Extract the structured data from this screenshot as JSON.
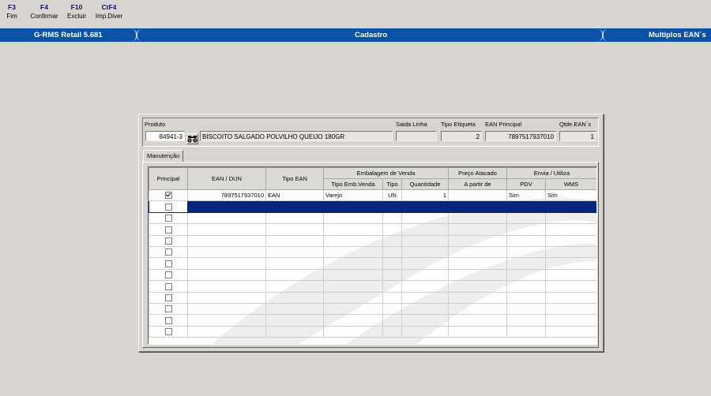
{
  "fkeys": [
    {
      "key": "F3",
      "label": "Fim"
    },
    {
      "key": "F4",
      "label": "Confirmar"
    },
    {
      "key": "F10",
      "label": "Excluir"
    },
    {
      "key": "CtF4",
      "label": "Imp.Diver"
    }
  ],
  "titlebar": {
    "app": "G-RMS Retail 5.681",
    "screen": "Cadastro",
    "context": "Multiplos EAN´s"
  },
  "header": {
    "produto_label": "Produto",
    "produto_code": "84941-3",
    "produto_desc": "BISCOITO SALGADO POLVILHO QUEIJO 180GR",
    "saida_linha_label": "Saida Linha",
    "saida_linha": "",
    "tipo_etiqueta_label": "Tipo Etiqueta",
    "tipo_etiqueta": "2",
    "ean_principal_label": "EAN Principal",
    "ean_principal": "7897517937010",
    "qtde_ean_label": "Qtde.EAN´s",
    "qtde_ean": "1"
  },
  "tab": "Manutenção",
  "columns": {
    "principal": "Principal",
    "ean_dun": "EAN / DUN",
    "tipo_ean": "Tipo EAN",
    "embalagem_group": "Embalagem de Venda",
    "tipo_emb_venda": "Tipo Emb.Venda",
    "tipo": "Tipo",
    "quantidade": "Quantidade",
    "preco_group": "Preço Atacado",
    "a_partir_de": "A partir de",
    "envia_group": "Envia / Utiliza",
    "pdv": "PDV",
    "wms": "WMS"
  },
  "rows": [
    {
      "principal": true,
      "ean": "7897517937010",
      "tipo_ean": "EAN",
      "tipo_emb": "Varejo",
      "tipo": "UN",
      "qtd": "1",
      "a_partir": "",
      "pdv": "Sim",
      "wms": "Sim"
    },
    {
      "principal": false,
      "ean": "",
      "tipo_ean": "",
      "tipo_emb": "",
      "tipo": "",
      "qtd": "",
      "a_partir": "",
      "pdv": "",
      "wms": ""
    },
    {
      "principal": false,
      "ean": "",
      "tipo_ean": "",
      "tipo_emb": "",
      "tipo": "",
      "qtd": "",
      "a_partir": "",
      "pdv": "",
      "wms": ""
    },
    {
      "principal": false,
      "ean": "",
      "tipo_ean": "",
      "tipo_emb": "",
      "tipo": "",
      "qtd": "",
      "a_partir": "",
      "pdv": "",
      "wms": ""
    },
    {
      "principal": false,
      "ean": "",
      "tipo_ean": "",
      "tipo_emb": "",
      "tipo": "",
      "qtd": "",
      "a_partir": "",
      "pdv": "",
      "wms": ""
    },
    {
      "principal": false,
      "ean": "",
      "tipo_ean": "",
      "tipo_emb": "",
      "tipo": "",
      "qtd": "",
      "a_partir": "",
      "pdv": "",
      "wms": ""
    },
    {
      "principal": false,
      "ean": "",
      "tipo_ean": "",
      "tipo_emb": "",
      "tipo": "",
      "qtd": "",
      "a_partir": "",
      "pdv": "",
      "wms": ""
    },
    {
      "principal": false,
      "ean": "",
      "tipo_ean": "",
      "tipo_emb": "",
      "tipo": "",
      "qtd": "",
      "a_partir": "",
      "pdv": "",
      "wms": ""
    },
    {
      "principal": false,
      "ean": "",
      "tipo_ean": "",
      "tipo_emb": "",
      "tipo": "",
      "qtd": "",
      "a_partir": "",
      "pdv": "",
      "wms": ""
    },
    {
      "principal": false,
      "ean": "",
      "tipo_ean": "",
      "tipo_emb": "",
      "tipo": "",
      "qtd": "",
      "a_partir": "",
      "pdv": "",
      "wms": ""
    },
    {
      "principal": false,
      "ean": "",
      "tipo_ean": "",
      "tipo_emb": "",
      "tipo": "",
      "qtd": "",
      "a_partir": "",
      "pdv": "",
      "wms": ""
    },
    {
      "principal": false,
      "ean": "",
      "tipo_ean": "",
      "tipo_emb": "",
      "tipo": "",
      "qtd": "",
      "a_partir": "",
      "pdv": "",
      "wms": ""
    },
    {
      "principal": false,
      "ean": "",
      "tipo_ean": "",
      "tipo_emb": "",
      "tipo": "",
      "qtd": "",
      "a_partir": "",
      "pdv": "",
      "wms": ""
    }
  ],
  "selected_row": 1,
  "colors": {
    "titlebar": "#0a52a8",
    "selection": "#06247a",
    "fkey": "#12127a",
    "background": "#d8d5d0"
  }
}
